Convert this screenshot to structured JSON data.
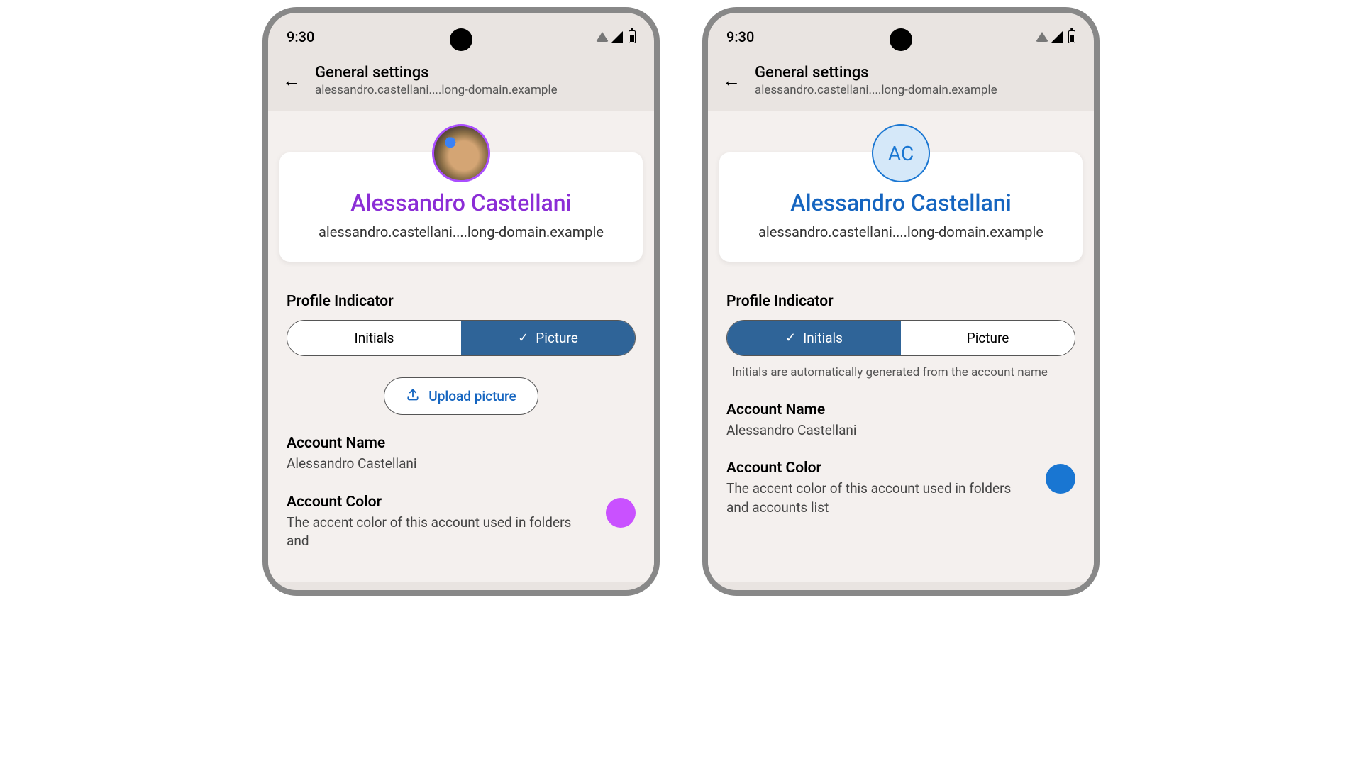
{
  "status": {
    "time": "9:30"
  },
  "header": {
    "title": "General settings",
    "subtitle": "alessandro.castellani....long-domain.example"
  },
  "profile": {
    "name": "Alessandro Castellani",
    "email": "alessandro.castellani....long-domain.example",
    "initials": "AC"
  },
  "indicator": {
    "label": "Profile Indicator",
    "initials": "Initials",
    "picture": "Picture",
    "helper": "Initials are automatically generated from the account name"
  },
  "upload": {
    "label": "Upload picture"
  },
  "account_name": {
    "label": "Account Name",
    "value": "Alessandro Castellani"
  },
  "account_color": {
    "label": "Account Color",
    "desc_full": "The accent color of this account used in folders and accounts list",
    "desc_cut": "The accent color of this account used in folders and"
  },
  "colors": {
    "purple_accent": "#c951ff",
    "blue_accent": "#1976d2"
  }
}
